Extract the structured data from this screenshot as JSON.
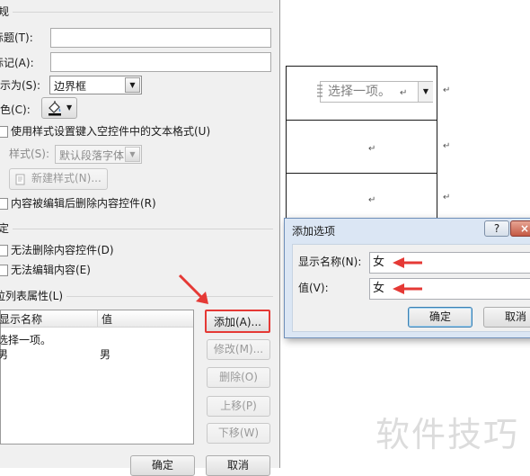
{
  "props": {
    "section_general": "规",
    "title_label": "标题(T):",
    "tag_label": "标记(A):",
    "show_as_label": "显示为(S):",
    "show_as_value": "边界框",
    "color_label": "颜色(C):",
    "use_style_label": "使用样式设置键入空控件中的文本格式(U)",
    "style_label": "样式(S):",
    "style_value": "默认段落字体",
    "new_style_btn": "新建样式(N)...",
    "remove_after_edit_label": "内容被编辑后删除内容控件(R)",
    "section_lock": "定",
    "no_delete_label": "无法删除内容控件(D)",
    "no_edit_label": "无法编辑内容(E)",
    "section_list": "拉列表属性(L)",
    "list_header_name": "显示名称",
    "list_header_value": "值",
    "list_items": [
      {
        "name": "选择一项。",
        "value": ""
      },
      {
        "name": "男",
        "value": "男"
      }
    ],
    "add_btn": "添加(A)...",
    "modify_btn": "修改(M)...",
    "delete_btn": "删除(O)",
    "up_btn": "上移(P)",
    "down_btn": "下移(W)",
    "ok_btn": "确定",
    "cancel_btn": "取消"
  },
  "doc": {
    "placeholder": "选择一项。",
    "para_mark": "↵"
  },
  "add_option": {
    "title": "添加选项",
    "help": "?",
    "display_name_label": "显示名称(N):",
    "display_name_value": "女",
    "value_label": "值(V):",
    "value_value": "女",
    "ok_btn": "确定",
    "cancel_btn": "取消"
  },
  "watermark": "软件技巧",
  "colors": {
    "highlight_red": "#e53935",
    "dialog_border": "#6f8fb9",
    "dialog_frame": "#dbe6f4",
    "ok_focus": "#3c7fb1"
  }
}
